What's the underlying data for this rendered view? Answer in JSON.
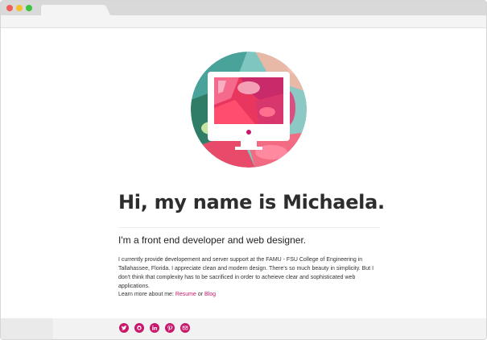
{
  "profile": {
    "headline": "Hi, my name is Michaela.",
    "subtitle": "I'm a front end developer and web designer.",
    "bio": "I currently provide developement and server support at the FAMU - FSU College of Engineering in Tallahassee, Florida. I appreciate clean and modern design. There's so much beauty in simplicity. But I don't think that complexity has to be sacrificed in order to acheieve clear and sophisticated web applications.",
    "learn_more_prefix": "Learn more about me:",
    "resume_link": "Resume",
    "or_text": "or",
    "blog_link": "Blog"
  },
  "social": [
    {
      "icon": "twitter-icon"
    },
    {
      "icon": "github-icon"
    },
    {
      "icon": "linkedin-icon"
    },
    {
      "icon": "pinterest-icon"
    },
    {
      "icon": "email-icon"
    }
  ],
  "colors": {
    "accent": "#c8176a",
    "text": "#2d2d2d",
    "chrome": "#d9d9d9"
  }
}
